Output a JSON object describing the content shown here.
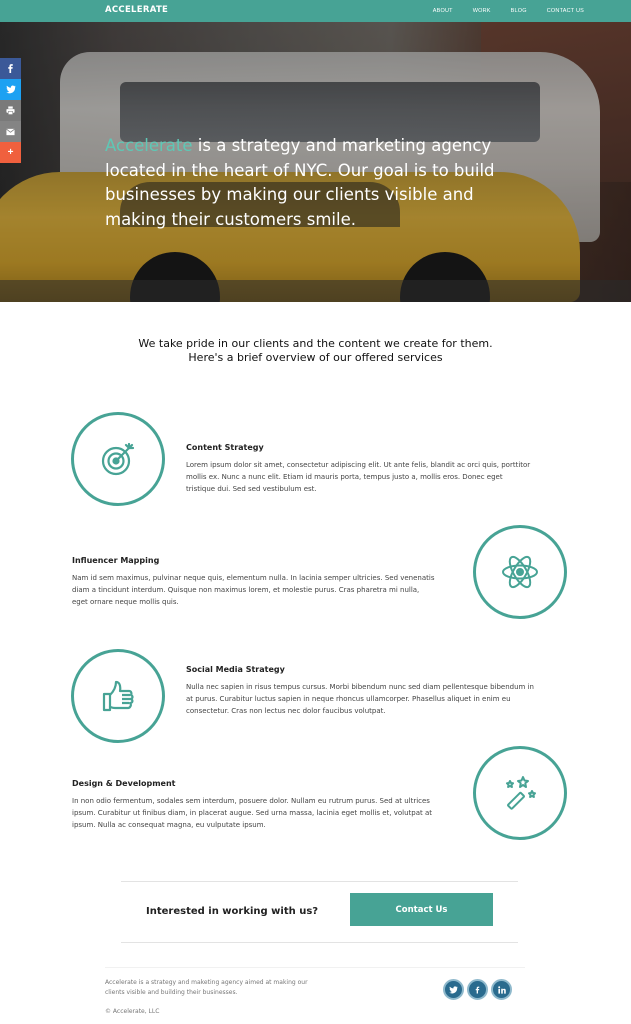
{
  "nav": {
    "logo": "ACCELERATE",
    "links": [
      "ABOUT",
      "WORK",
      "BLOG",
      "CONTACT US"
    ]
  },
  "share": {
    "facebook": "f",
    "twitter": "t",
    "print": "p",
    "email": "e",
    "plus": "+"
  },
  "hero": {
    "accent": "Accelerate",
    "text": " is a strategy and marketing agency located in the heart of NYC. Our goal is to build businesses by making our clients visible and making their customers smile."
  },
  "intro": {
    "line1": "We take pride in our clients and the content we create for them.",
    "line2": "Here's a brief overview of our offered services"
  },
  "services": [
    {
      "title": "Content Strategy",
      "body": "Lorem ipsum dolor sit amet, consectetur adipiscing elit. Ut ante felis, blandit ac orci quis, porttitor mollis ex. Nunc a nunc elit. Etiam id mauris porta, tempus justo a, mollis eros. Donec eget tristique dui. Sed sed vestibulum est.",
      "icon": "target-icon"
    },
    {
      "title": "Influencer Mapping",
      "body": "Nam id sem maximus, pulvinar neque quis, elementum nulla. In lacinia semper ultricies. Sed venenatis diam a tincidunt interdum. Quisque non maximus lorem, et molestie purus. Cras pharetra mi nulla, eget ornare neque mollis quis.",
      "icon": "atom-icon"
    },
    {
      "title": "Social Media Strategy",
      "body": "Nulla nec sapien in risus tempus cursus. Morbi bibendum nunc sed diam pellentesque bibendum in at purus. Curabitur luctus sapien in neque rhoncus ullamcorper. Phasellus aliquet in enim eu consectetur. Cras non lectus nec dolor faucibus volutpat.",
      "icon": "thumbs-up-icon"
    },
    {
      "title": "Design & Development",
      "body": "In non odio fermentum, sodales sem interdum, posuere dolor. Nullam eu rutrum purus. Sed at ultrices ipsum. Curabitur ut finibus diam, in placerat augue. Sed urna massa, lacinia eget mollis et, volutpat at ipsum. Nulla ac consequat magna, eu vulputate ipsum.",
      "icon": "magic-wand-icon"
    }
  ],
  "cta": {
    "question": "Interested in working with us?",
    "button": "Contact Us"
  },
  "footer": {
    "description": "Accelerate is a strategy and maketing agency aimed at making our clients visible and building their businesses.",
    "copyright": "© Accelerate, LLC",
    "social": [
      "twitter-icon",
      "facebook-icon",
      "linkedin-icon"
    ]
  },
  "colors": {
    "accent": "#47a395",
    "hero_accent_text": "#5fc7b5"
  }
}
